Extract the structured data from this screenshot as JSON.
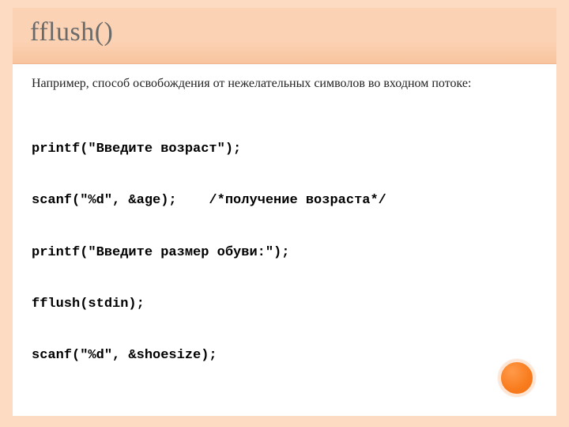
{
  "title": "fflush()",
  "intro": "Например, способ освобождения от нежелательных символов во входном потоке:",
  "code_lines": [
    "printf(\"Введите возраст\");",
    "scanf(\"%d\", &age);    /*получение возраста*/",
    "printf(\"Введите размер обуви:\");",
    "fflush(stdin);",
    "scanf(\"%d\", &shoesize);"
  ],
  "colors": {
    "border": "#fddac2",
    "band": "#fcd2b4",
    "accent": "#f97e20"
  }
}
